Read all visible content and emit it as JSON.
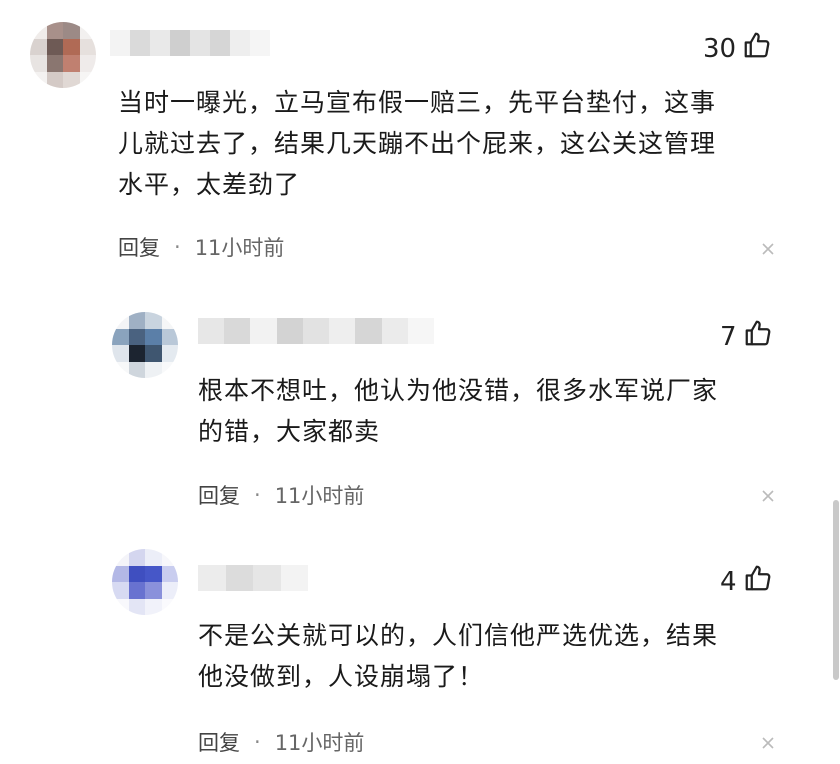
{
  "comments": [
    {
      "likes": "30",
      "text": "当时一曝光，立马宣布假一赔三，先平台垫付，这事\n儿就过去了，结果几天蹦不出个屁来，这公关这管理\n水平，太差劲了",
      "reply_label": "回复",
      "separator": "·",
      "time": "11小时前"
    },
    {
      "likes": "7",
      "text": "根本不想吐，他认为他没错，很多水军说厂家\n的错，大家都卖",
      "reply_label": "回复",
      "separator": "·",
      "time": "11小时前"
    },
    {
      "likes": "4",
      "text": "不是公关就可以的，人们信他严选优选，结果\n他没做到，人设崩塌了！",
      "reply_label": "回复",
      "separator": "·",
      "time": "11小时前"
    }
  ],
  "icons": {
    "like": "thumbs-up-icon",
    "close": "close-icon"
  },
  "colors": {
    "text": "#1a1a1a",
    "meta": "#666666",
    "close": "#bbbbbb"
  }
}
